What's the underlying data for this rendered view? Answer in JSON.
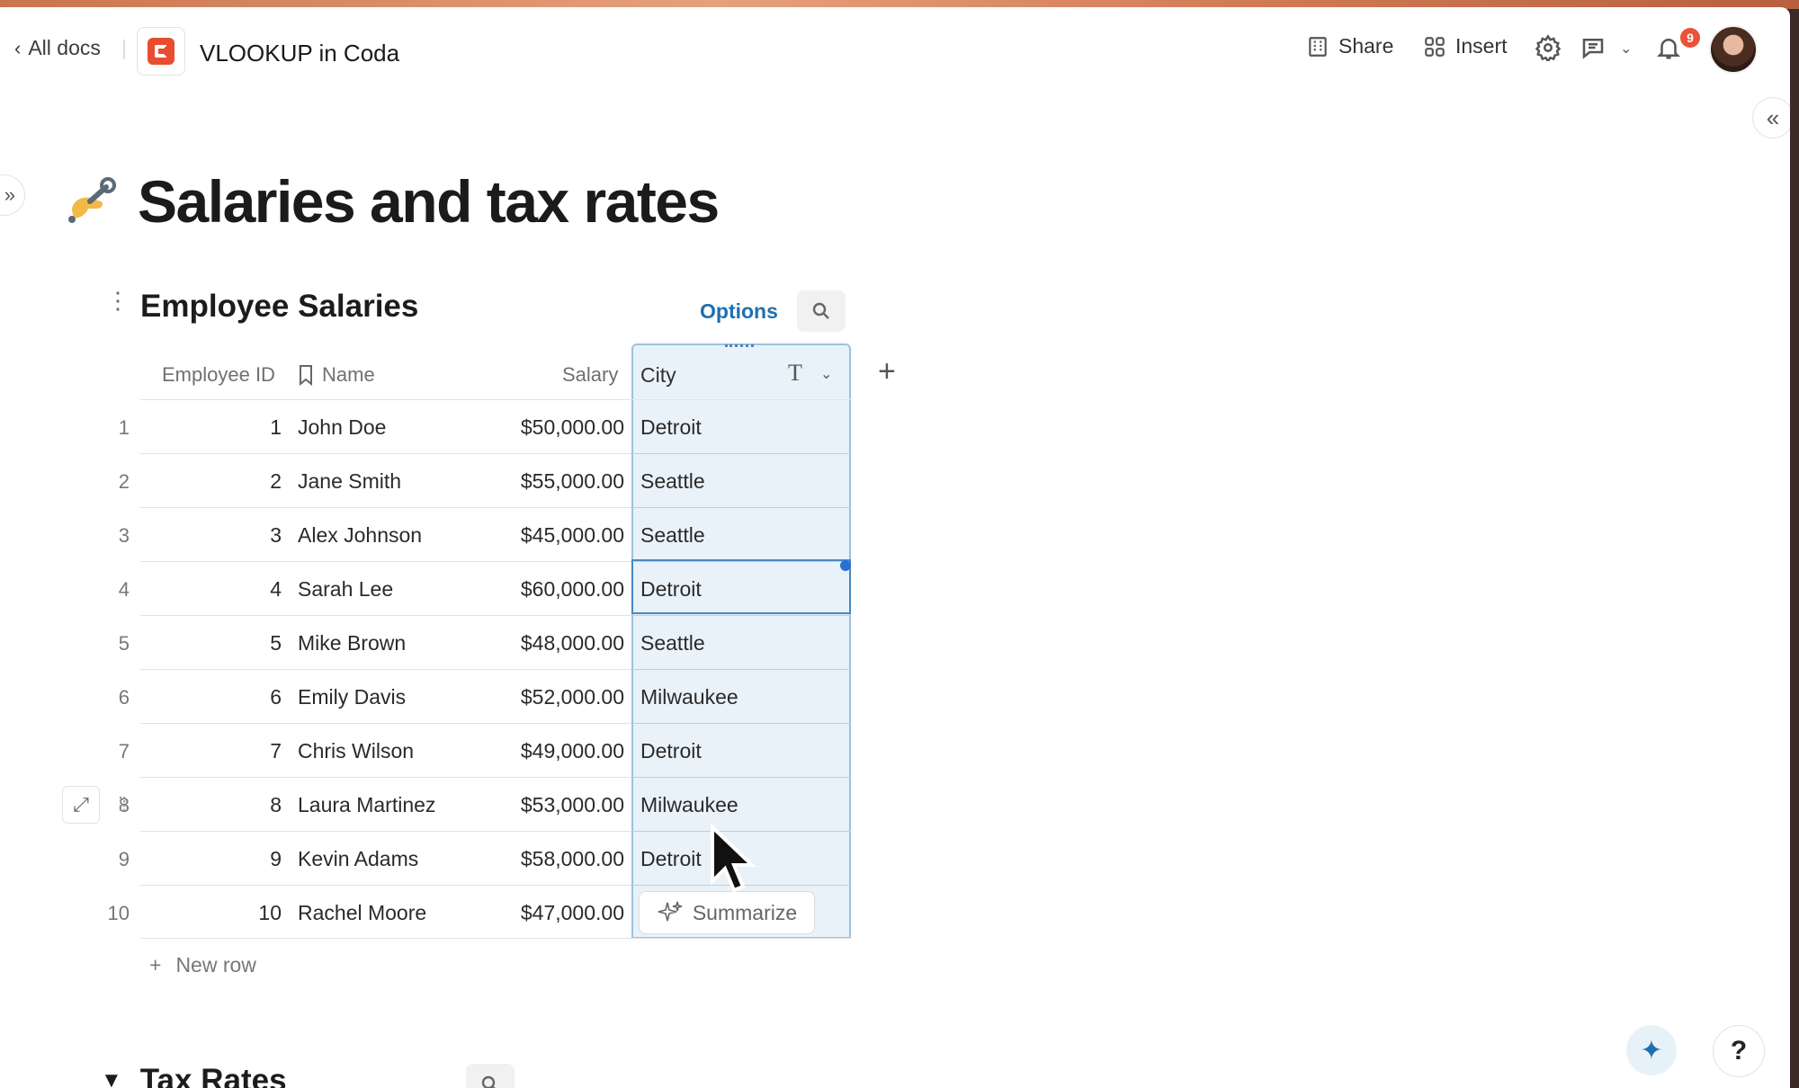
{
  "header": {
    "back_label": "All docs",
    "doc_title": "VLOOKUP in Coda",
    "share_label": "Share",
    "insert_label": "Insert",
    "notification_count": "9"
  },
  "page": {
    "title": "Salaries and tax rates"
  },
  "table": {
    "title": "Employee Salaries",
    "options_label": "Options",
    "columns": [
      "Employee ID",
      "Name",
      "Salary",
      "City"
    ],
    "rows": [
      {
        "num": "1",
        "id": "1",
        "name": "John Doe",
        "salary": "$50,000.00",
        "city": "Detroit"
      },
      {
        "num": "2",
        "id": "2",
        "name": "Jane Smith",
        "salary": "$55,000.00",
        "city": "Seattle"
      },
      {
        "num": "3",
        "id": "3",
        "name": "Alex Johnson",
        "salary": "$45,000.00",
        "city": "Seattle"
      },
      {
        "num": "4",
        "id": "4",
        "name": "Sarah Lee",
        "salary": "$60,000.00",
        "city": "Detroit"
      },
      {
        "num": "5",
        "id": "5",
        "name": "Mike Brown",
        "salary": "$48,000.00",
        "city": "Seattle"
      },
      {
        "num": "6",
        "id": "6",
        "name": "Emily Davis",
        "salary": "$52,000.00",
        "city": "Milwaukee"
      },
      {
        "num": "7",
        "id": "7",
        "name": "Chris Wilson",
        "salary": "$49,000.00",
        "city": "Detroit"
      },
      {
        "num": "8",
        "id": "8",
        "name": "Laura Martinez",
        "salary": "$53,000.00",
        "city": "Milwaukee"
      },
      {
        "num": "9",
        "id": "9",
        "name": "Kevin Adams",
        "salary": "$58,000.00",
        "city": "Detroit"
      },
      {
        "num": "10",
        "id": "10",
        "name": "Rachel Moore",
        "salary": "$47,000.00",
        "city": ""
      }
    ],
    "summarize_label": "Summarize",
    "new_row_label": "New row"
  },
  "tax_section": {
    "title": "Tax Rates"
  },
  "help_label": "?"
}
